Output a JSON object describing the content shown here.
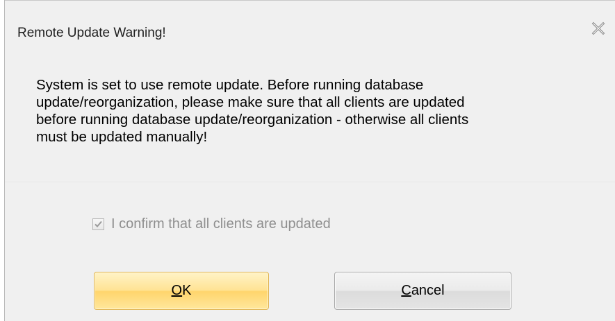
{
  "dialog": {
    "title": "Remote Update Warning!",
    "close_icon": "close-x-icon",
    "message": "System is set to use remote update. Before running database\nupdate/reorganization, please make sure that all clients are updated\nbefore running database update/reorganization - otherwise all clients\nmust be updated manually!",
    "confirm": {
      "label": "I confirm that all clients are updated",
      "checked": true,
      "enabled": false
    },
    "buttons": {
      "ok": {
        "mnemonic": "O",
        "rest": "K"
      },
      "cancel": {
        "mnemonic": "C",
        "rest": "ancel"
      }
    }
  },
  "colors": {
    "body_background": "#f0f0f0",
    "ok_button": "#ffe394",
    "cancel_button": "#e4e4e4",
    "disabled_text": "#8f8f8f"
  }
}
